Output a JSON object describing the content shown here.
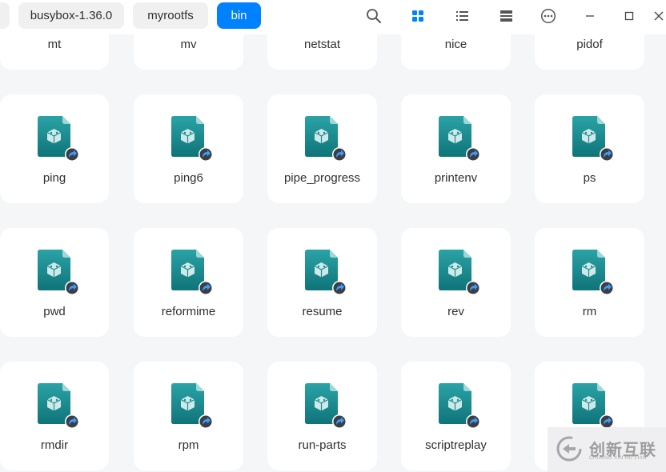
{
  "breadcrumbs": [
    {
      "label": "busybox-1.36.0"
    },
    {
      "label": "myrootfs"
    },
    {
      "label": "bin"
    }
  ],
  "toolbar": {
    "icons": [
      "search-icon",
      "icon-view-icon",
      "list-view-icon",
      "details-view-icon",
      "more-icon",
      "minimize-icon",
      "maximize-icon",
      "close-icon"
    ],
    "active_view": "icon-view",
    "accent_color": "#0081ff"
  },
  "files_partial_row": [
    "mt",
    "mv",
    "netstat",
    "nice",
    "pidof"
  ],
  "files": [
    {
      "name": "ping"
    },
    {
      "name": "ping6"
    },
    {
      "name": "pipe_progress"
    },
    {
      "name": "printenv"
    },
    {
      "name": "ps"
    },
    {
      "name": "pwd"
    },
    {
      "name": "reformime"
    },
    {
      "name": "resume"
    },
    {
      "name": "rev"
    },
    {
      "name": "rm"
    },
    {
      "name": "rmdir"
    },
    {
      "name": "rpm"
    },
    {
      "name": "run-parts"
    },
    {
      "name": "scriptreplay"
    },
    {
      "name": ""
    }
  ],
  "watermark": {
    "main": "创新互联",
    "sub": "CHUANG XIN HU LIAN"
  }
}
